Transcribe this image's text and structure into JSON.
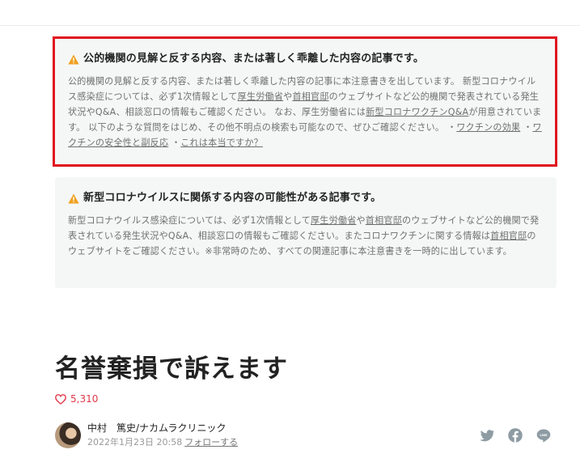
{
  "notices": {
    "primary": {
      "title": "公的機関の見解と反する内容、または著しく乖離した内容の記事です。",
      "p1": "公的機関の見解と反する内容、または著しく乖離した内容の記事に本注意書きを出しています。 新型コロナウイルス感染症については、必ず1次情報として",
      "link_mhlw": "厚生労働省",
      "sep_ya": "や",
      "link_kantei": "首相官邸",
      "p2": "のウェブサイトなど公的機関で発表されている発生状況やQ&A、相談窓口の情報もご確認ください。 なお、厚生労働省には",
      "link_vaccine_qa": "新型コロナワクチンQ&A",
      "p3": "が用意されています。 以下のような質問をはじめ、その他不明点の検索も可能なので、ぜひご確認ください。 ・",
      "link_effect": "ワクチンの効果",
      "bullet2": " ・",
      "link_safety": "ワクチンの安全性と副反応",
      "bullet3": " ・",
      "link_true": "これは本当ですか？"
    },
    "secondary": {
      "title": "新型コロナウイルスに関係する内容の可能性がある記事です。",
      "p1": "新型コロナウイルス感染症については、必ず1次情報として",
      "link_mhlw": "厚生労働省",
      "sep_ya": "や",
      "link_kantei": "首相官邸",
      "p2": "のウェブサイトなど公的機関で発表されている発生状況やQ&A、相談窓口の情報もご確認ください。またコロナワクチンに関する情報は",
      "link_kantei2": "首相官邸",
      "p3": "のウェブサイトをご確認ください。※非常時のため、すべての関連記事に本注意書きを一時的に出しています。"
    }
  },
  "article": {
    "title": "名誉棄損で訴えます",
    "likes": "5,310"
  },
  "author": {
    "name": "中村　篤史/ナカムラクリニック",
    "date": "2022年1月23日 20:58",
    "follow": "フォローする"
  },
  "colors": {
    "highlight_border": "#e0141e",
    "warning": "#f0a020",
    "like": "#e0394a",
    "share_icon": "#8d9ba3"
  },
  "icons": [
    "warning-icon",
    "heart-icon",
    "twitter-icon",
    "facebook-icon",
    "line-icon"
  ]
}
